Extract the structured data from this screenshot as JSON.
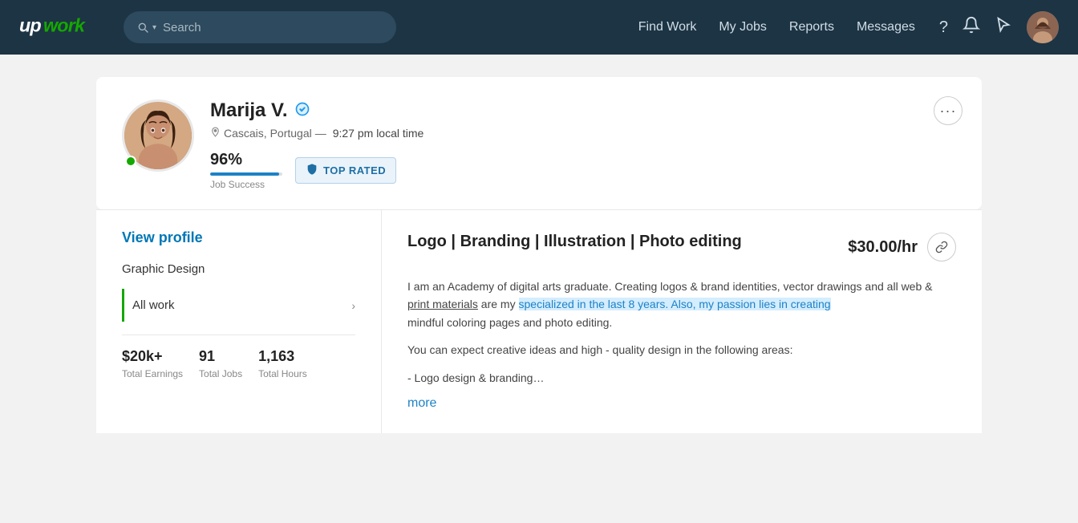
{
  "header": {
    "logo": "upwork",
    "search_placeholder": "Search",
    "nav": {
      "find_work": "Find Work",
      "my_jobs": "My Jobs",
      "reports": "Reports",
      "messages": "Messages"
    },
    "icons": {
      "help": "?",
      "notifications": "🔔",
      "cursor": "↖"
    }
  },
  "profile": {
    "name": "Marija V.",
    "verified": true,
    "location": "Cascais, Portugal",
    "local_time": "9:27 pm local time",
    "job_success_pct": "96%",
    "job_success_label": "Job Success",
    "progress_width": "96",
    "badge": "TOP RATED",
    "more_btn": "···"
  },
  "left_panel": {
    "view_profile": "View profile",
    "category": "Graphic Design",
    "all_work": "All work",
    "stats": [
      {
        "value": "$20k+",
        "label": "Total Earnings"
      },
      {
        "value": "91",
        "label": "Total Jobs"
      },
      {
        "value": "1,163",
        "label": "Total Hours"
      }
    ]
  },
  "right_panel": {
    "gig_title": "Logo | Branding | Illustration | Photo editing",
    "gig_price": "$30.00/hr",
    "description_1": "I am an Academy of digital arts graduate. Creating logos & brand identities, vector drawings and all web & print materials are my specialized in the last 8 years. Also, my passion lies in creating mindful coloring pages and photo editing.",
    "description_2": "You can expect creative ideas and high - quality design in the following areas:",
    "description_3": "- Logo design & branding…",
    "more_link": "more"
  }
}
